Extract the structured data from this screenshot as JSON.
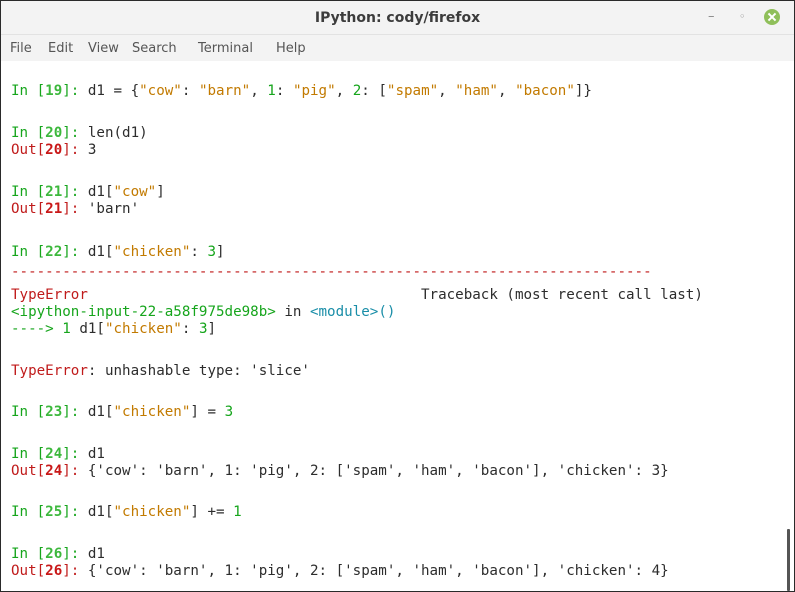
{
  "window": {
    "title": "IPython: cody/firefox",
    "minimize_glyph": "–",
    "maximize_glyph": "◦"
  },
  "menubar": {
    "items": [
      "File",
      "Edit",
      "View",
      "Search",
      "Terminal",
      "Help"
    ]
  },
  "terminal": {
    "lines": {
      "l19": {
        "prompt": "In [",
        "num": "19",
        "close": "]: ",
        "code_a": "d1 = {",
        "s1": "\"cow\"",
        "code_b": ": ",
        "s2": "\"barn\"",
        "code_c": ", ",
        "n1": "1",
        "code_d": ": ",
        "s3": "\"pig\"",
        "code_e": ", ",
        "n2": "2",
        "code_f": ": [",
        "s4": "\"spam\"",
        "code_g": ", ",
        "s5": "\"ham\"",
        "code_h": ", ",
        "s6": "\"bacon\"",
        "code_i": "]}"
      },
      "l20": {
        "prompt": "In [",
        "num": "20",
        "close": "]: ",
        "code": "len(d1)"
      },
      "o20": {
        "prompt": "Out[",
        "num": "20",
        "close": "]: ",
        "value": "3"
      },
      "l21": {
        "prompt": "In [",
        "num": "21",
        "close": "]: ",
        "code_a": "d1[",
        "s1": "\"cow\"",
        "code_b": "]"
      },
      "o21": {
        "prompt": "Out[",
        "num": "21",
        "close": "]: ",
        "value": "'barn'"
      },
      "l22": {
        "prompt": "In [",
        "num": "22",
        "close": "]: ",
        "code_a": "d1[",
        "s1": "\"chicken\"",
        "code_b": ": ",
        "n1": "3",
        "code_c": "]"
      },
      "dashes": "---------------------------------------------------------------------------",
      "err_type": "TypeError",
      "err_traceback": "Traceback (most recent call last)",
      "err_input": "<ipython-input-22-a58f975de98b>",
      "err_in": " in ",
      "err_module": "<module>",
      "err_parens": "()",
      "err_arrow": "----> 1 ",
      "err_code_a": "d1[",
      "err_s1": "\"chicken\"",
      "err_code_b": ": ",
      "err_n1": "3",
      "err_code_c": "]",
      "err_msg_type": "TypeError",
      "err_msg": ": unhashable type: 'slice'",
      "l23": {
        "prompt": "In [",
        "num": "23",
        "close": "]: ",
        "code_a": "d1[",
        "s1": "\"chicken\"",
        "code_b": "] = ",
        "n1": "3"
      },
      "l24": {
        "prompt": "In [",
        "num": "24",
        "close": "]: ",
        "code": "d1"
      },
      "o24": {
        "prompt": "Out[",
        "num": "24",
        "close": "]: ",
        "value": "{'cow': 'barn', 1: 'pig', 2: ['spam', 'ham', 'bacon'], 'chicken': 3}"
      },
      "l25": {
        "prompt": "In [",
        "num": "25",
        "close": "]: ",
        "code_a": "d1[",
        "s1": "\"chicken\"",
        "code_b": "] += ",
        "n1": "1"
      },
      "l26": {
        "prompt": "In [",
        "num": "26",
        "close": "]: ",
        "code": "d1"
      },
      "o26": {
        "prompt": "Out[",
        "num": "26",
        "close": "]: ",
        "value": "{'cow': 'barn', 1: 'pig', 2: ['spam', 'ham', 'bacon'], 'chicken': 4}"
      }
    }
  }
}
